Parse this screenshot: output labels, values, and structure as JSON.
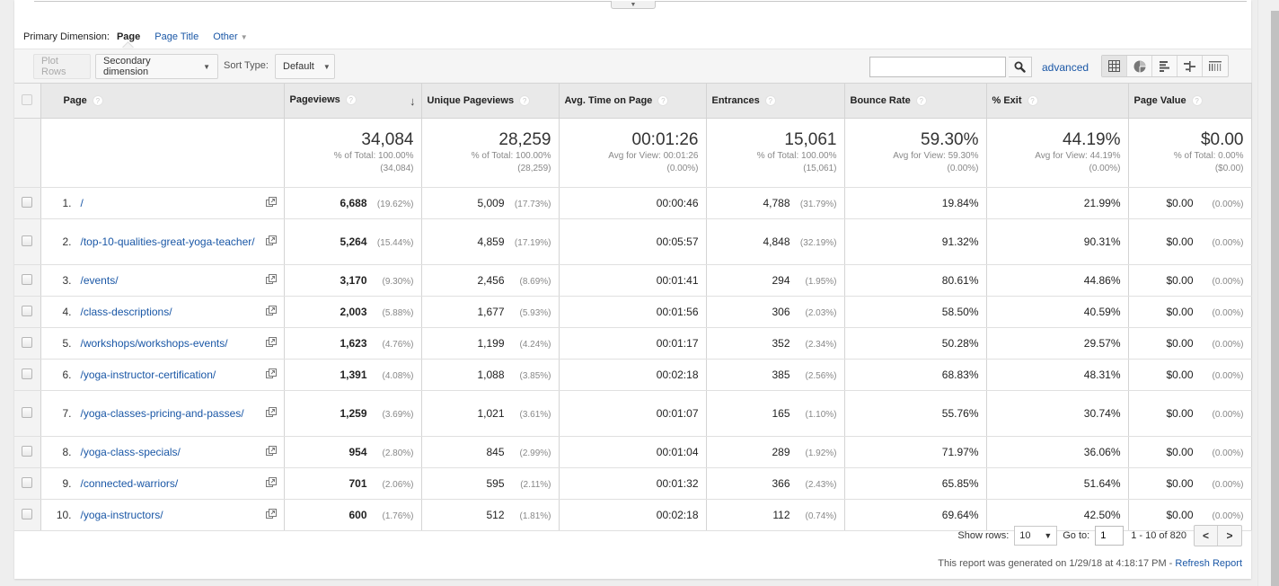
{
  "primary_dimension": {
    "label": "Primary Dimension:",
    "current": "Page",
    "options": [
      "Page Title",
      "Other"
    ]
  },
  "toolbar": {
    "plot_rows": "Plot Rows",
    "secondary_dimension": "Secondary dimension",
    "sort_type_label": "Sort Type:",
    "sort_type_value": "Default",
    "search_value": "",
    "advanced": "advanced",
    "views": [
      "data-table",
      "percentage-pie",
      "performance-bars",
      "comparison",
      "term-cloud"
    ]
  },
  "table": {
    "columns": [
      {
        "label": "Page",
        "help": "?"
      },
      {
        "label": "Pageviews",
        "help": "?",
        "sorted": "desc"
      },
      {
        "label": "Unique Pageviews",
        "help": "?"
      },
      {
        "label": "Avg. Time on Page",
        "help": "?"
      },
      {
        "label": "Entrances",
        "help": "?"
      },
      {
        "label": "Bounce Rate",
        "help": "?"
      },
      {
        "label": "% Exit",
        "help": "?"
      },
      {
        "label": "Page Value",
        "help": "?"
      }
    ],
    "summary": {
      "pageviews": {
        "value": "34,084",
        "sub1": "% of Total: 100.00%",
        "sub2": "(34,084)"
      },
      "unique_pageviews": {
        "value": "28,259",
        "sub1": "% of Total: 100.00%",
        "sub2": "(28,259)"
      },
      "avg_time": {
        "value": "00:01:26",
        "sub1": "Avg for View: 00:01:26",
        "sub2": "(0.00%)"
      },
      "entrances": {
        "value": "15,061",
        "sub1": "% of Total: 100.00%",
        "sub2": "(15,061)"
      },
      "bounce_rate": {
        "value": "59.30%",
        "sub1": "Avg for View: 59.30%",
        "sub2": "(0.00%)"
      },
      "exit": {
        "value": "44.19%",
        "sub1": "Avg for View: 44.19%",
        "sub2": "(0.00%)"
      },
      "page_value": {
        "value": "$0.00",
        "sub1": "% of Total: 0.00%",
        "sub2": "($0.00)"
      }
    },
    "rows": [
      {
        "num": "1.",
        "page": "/",
        "pageviews": "6,688",
        "pageviews_pct": "(19.62%)",
        "unique": "5,009",
        "unique_pct": "(17.73%)",
        "avg_time": "00:00:46",
        "entrances": "4,788",
        "entrances_pct": "(31.79%)",
        "bounce": "19.84%",
        "exit": "21.99%",
        "value": "$0.00",
        "value_pct": "(0.00%)"
      },
      {
        "num": "2.",
        "page": "/top-10-qualities-great-yoga-teacher/",
        "pageviews": "5,264",
        "pageviews_pct": "(15.44%)",
        "unique": "4,859",
        "unique_pct": "(17.19%)",
        "avg_time": "00:05:57",
        "entrances": "4,848",
        "entrances_pct": "(32.19%)",
        "bounce": "91.32%",
        "exit": "90.31%",
        "value": "$0.00",
        "value_pct": "(0.00%)"
      },
      {
        "num": "3.",
        "page": "/events/",
        "pageviews": "3,170",
        "pageviews_pct": "(9.30%)",
        "unique": "2,456",
        "unique_pct": "(8.69%)",
        "avg_time": "00:01:41",
        "entrances": "294",
        "entrances_pct": "(1.95%)",
        "bounce": "80.61%",
        "exit": "44.86%",
        "value": "$0.00",
        "value_pct": "(0.00%)"
      },
      {
        "num": "4.",
        "page": "/class-descriptions/",
        "pageviews": "2,003",
        "pageviews_pct": "(5.88%)",
        "unique": "1,677",
        "unique_pct": "(5.93%)",
        "avg_time": "00:01:56",
        "entrances": "306",
        "entrances_pct": "(2.03%)",
        "bounce": "58.50%",
        "exit": "40.59%",
        "value": "$0.00",
        "value_pct": "(0.00%)"
      },
      {
        "num": "5.",
        "page": "/workshops/workshops-events/",
        "pageviews": "1,623",
        "pageviews_pct": "(4.76%)",
        "unique": "1,199",
        "unique_pct": "(4.24%)",
        "avg_time": "00:01:17",
        "entrances": "352",
        "entrances_pct": "(2.34%)",
        "bounce": "50.28%",
        "exit": "29.57%",
        "value": "$0.00",
        "value_pct": "(0.00%)"
      },
      {
        "num": "6.",
        "page": "/yoga-instructor-certification/",
        "pageviews": "1,391",
        "pageviews_pct": "(4.08%)",
        "unique": "1,088",
        "unique_pct": "(3.85%)",
        "avg_time": "00:02:18",
        "entrances": "385",
        "entrances_pct": "(2.56%)",
        "bounce": "68.83%",
        "exit": "48.31%",
        "value": "$0.00",
        "value_pct": "(0.00%)"
      },
      {
        "num": "7.",
        "page": "/yoga-classes-pricing-and-passes/",
        "pageviews": "1,259",
        "pageviews_pct": "(3.69%)",
        "unique": "1,021",
        "unique_pct": "(3.61%)",
        "avg_time": "00:01:07",
        "entrances": "165",
        "entrances_pct": "(1.10%)",
        "bounce": "55.76%",
        "exit": "30.74%",
        "value": "$0.00",
        "value_pct": "(0.00%)"
      },
      {
        "num": "8.",
        "page": "/yoga-class-specials/",
        "pageviews": "954",
        "pageviews_pct": "(2.80%)",
        "unique": "845",
        "unique_pct": "(2.99%)",
        "avg_time": "00:01:04",
        "entrances": "289",
        "entrances_pct": "(1.92%)",
        "bounce": "71.97%",
        "exit": "36.06%",
        "value": "$0.00",
        "value_pct": "(0.00%)"
      },
      {
        "num": "9.",
        "page": "/connected-warriors/",
        "pageviews": "701",
        "pageviews_pct": "(2.06%)",
        "unique": "595",
        "unique_pct": "(2.11%)",
        "avg_time": "00:01:32",
        "entrances": "366",
        "entrances_pct": "(2.43%)",
        "bounce": "65.85%",
        "exit": "51.64%",
        "value": "$0.00",
        "value_pct": "(0.00%)"
      },
      {
        "num": "10.",
        "page": "/yoga-instructors/",
        "pageviews": "600",
        "pageviews_pct": "(1.76%)",
        "unique": "512",
        "unique_pct": "(1.81%)",
        "avg_time": "00:02:18",
        "entrances": "112",
        "entrances_pct": "(0.74%)",
        "bounce": "69.64%",
        "exit": "42.50%",
        "value": "$0.00",
        "value_pct": "(0.00%)"
      }
    ]
  },
  "footer": {
    "show_rows_label": "Show rows:",
    "show_rows_value": "10",
    "goto_label": "Go to:",
    "goto_value": "1",
    "range": "1 - 10 of 820",
    "prev": "<",
    "next": ">",
    "generated_text": "This report was generated on 1/29/18 at 4:18:17 PM - ",
    "refresh": "Refresh Report"
  },
  "colors": {
    "link": "#1a57a6",
    "header_bg": "#e9e9e9",
    "muted": "#888888"
  }
}
